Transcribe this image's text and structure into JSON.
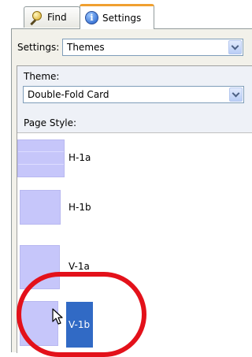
{
  "tabs": [
    {
      "label": "Find",
      "icon": "find-icon"
    },
    {
      "label": "Settings",
      "icon": "info-icon",
      "active": true
    }
  ],
  "settings": {
    "label": "Settings:",
    "value": "Themes"
  },
  "theme": {
    "label": "Theme:",
    "value": "Double-Fold Card"
  },
  "page_style": {
    "label": "Page Style:",
    "items": [
      {
        "name": "H-1a"
      },
      {
        "name": "H-1b"
      },
      {
        "name": "V-1a"
      },
      {
        "name": "V-1b",
        "selected": true
      }
    ]
  },
  "colors": {
    "accent": "#316ac5",
    "thumb": "#c6c6fa",
    "highlight": "#e3111a",
    "tab_active_border": "#f0a030"
  }
}
